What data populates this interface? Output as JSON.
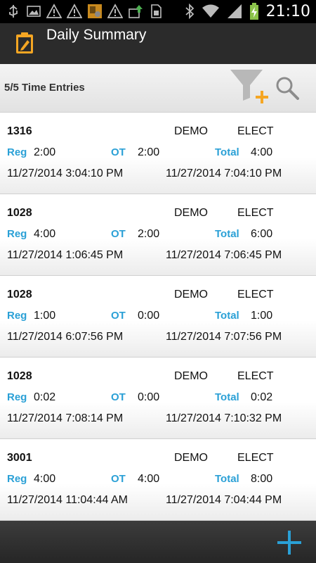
{
  "status_bar": {
    "time": "21:10"
  },
  "header": {
    "title": "Daily Summary"
  },
  "toolbar": {
    "entry_count": "5/5 Time Entries"
  },
  "labels": {
    "reg": "Reg",
    "ot": "OT",
    "total": "Total"
  },
  "entries": [
    {
      "job": "1316",
      "col2": "DEMO",
      "col3": "ELECT",
      "reg": "2:00",
      "ot": "2:00",
      "total": "4:00",
      "start": "11/27/2014 3:04:10 PM",
      "end": "11/27/2014 7:04:10 PM"
    },
    {
      "job": "1028",
      "col2": "DEMO",
      "col3": "ELECT",
      "reg": "4:00",
      "ot": "2:00",
      "total": "6:00",
      "start": "11/27/2014 1:06:45 PM",
      "end": "11/27/2014 7:06:45 PM"
    },
    {
      "job": "1028",
      "col2": "DEMO",
      "col3": "ELECT",
      "reg": "1:00",
      "ot": "0:00",
      "total": "1:00",
      "start": "11/27/2014 6:07:56 PM",
      "end": "11/27/2014 7:07:56 PM"
    },
    {
      "job": "1028",
      "col2": "DEMO",
      "col3": "ELECT",
      "reg": "0:02",
      "ot": "0:00",
      "total": "0:02",
      "start": "11/27/2014 7:08:14 PM",
      "end": "11/27/2014 7:10:32 PM"
    },
    {
      "job": "3001",
      "col2": "DEMO",
      "col3": "ELECT",
      "reg": "4:00",
      "ot": "4:00",
      "total": "8:00",
      "start": "11/27/2014 11:04:44 AM",
      "end": "11/27/2014 7:04:44 PM"
    }
  ],
  "colors": {
    "accent": "#2aa0d6",
    "add": "#2aa0d6",
    "filter_plus": "#f5a623"
  },
  "icons": {
    "status_left": [
      "usb-icon",
      "image-icon",
      "warning-icon",
      "warning-icon",
      "app-notification-icon",
      "warning-icon",
      "upload-icon",
      "sim-icon"
    ],
    "status_right": [
      "bluetooth-icon",
      "wifi-icon",
      "signal-icon",
      "battery-charging-icon"
    ],
    "app": "clipboard-edit-icon",
    "filter": "filter-add-icon",
    "search": "search-icon",
    "add": "plus-icon"
  }
}
